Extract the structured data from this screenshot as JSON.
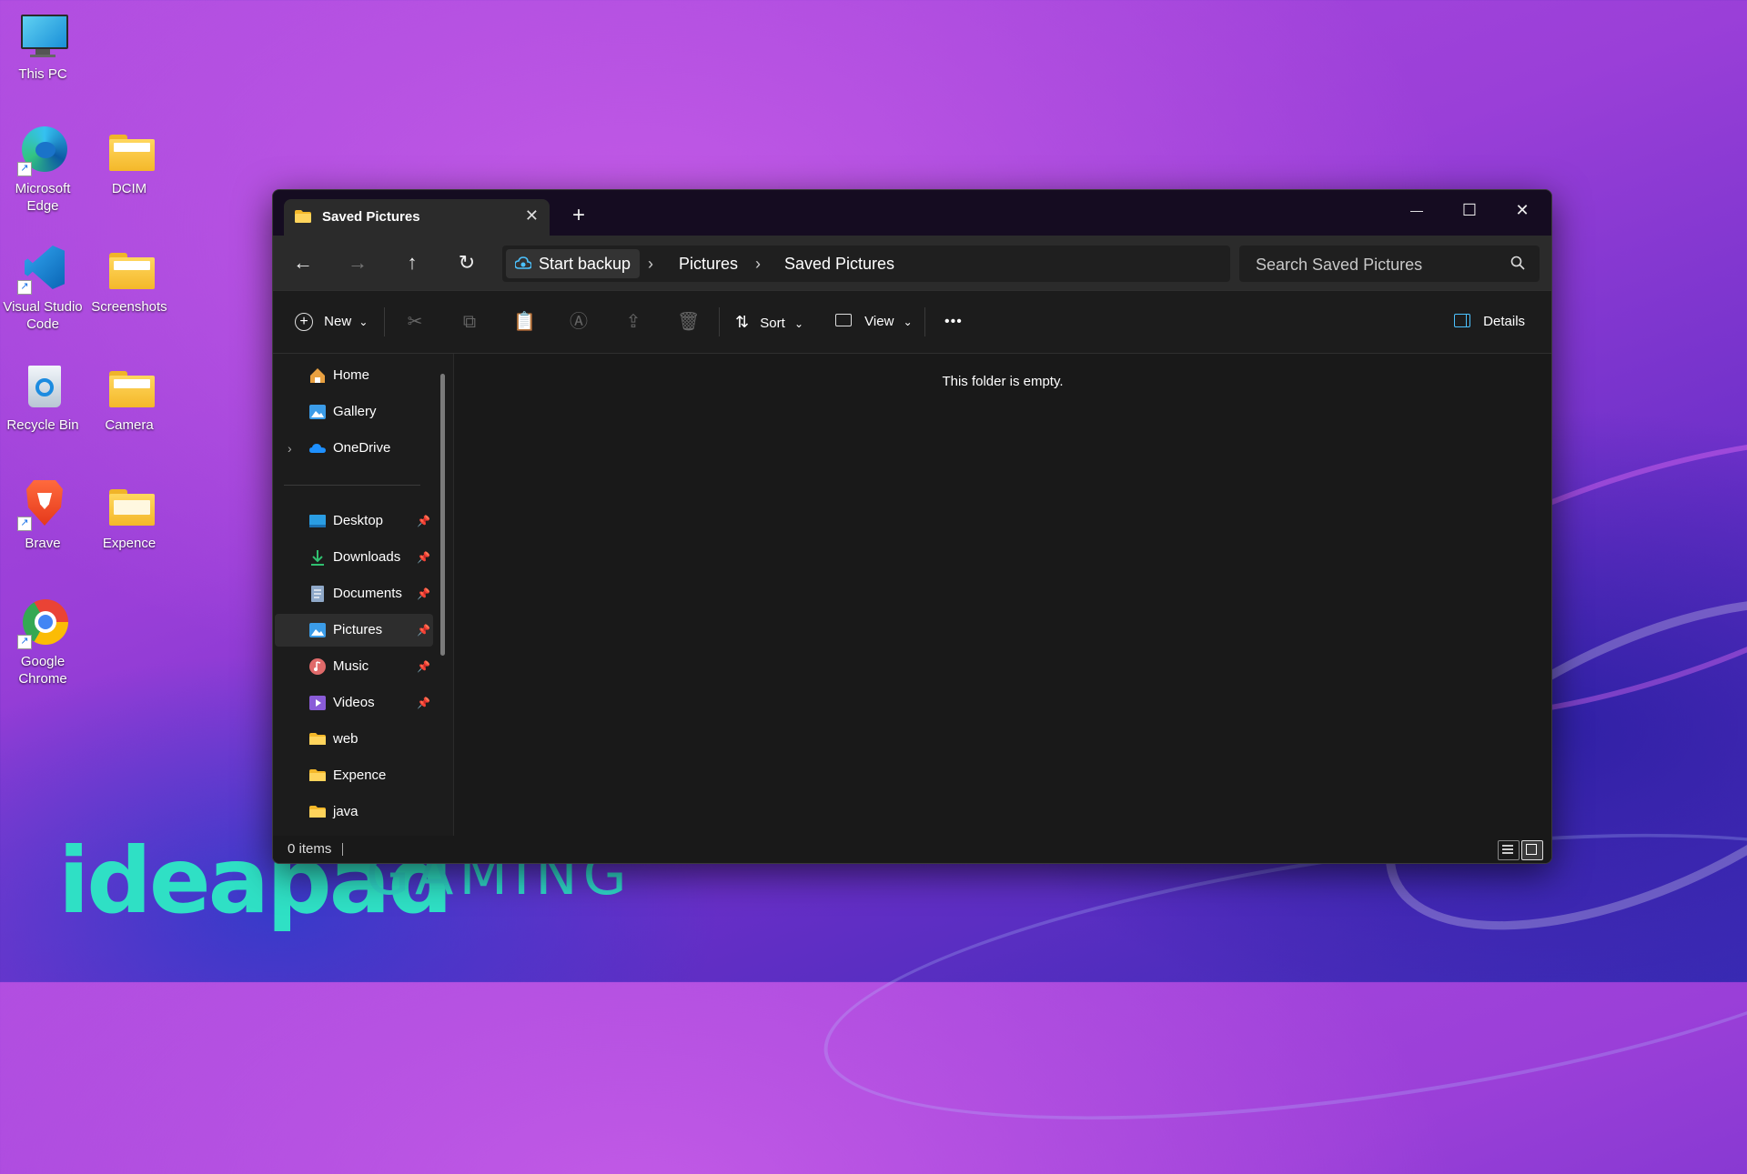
{
  "desktop": {
    "icons": [
      {
        "label": "This PC"
      },
      {
        "label": "Microsoft Edge"
      },
      {
        "label": "DCIM"
      },
      {
        "label": "Visual Studio Code"
      },
      {
        "label": "Screenshots"
      },
      {
        "label": "Recycle Bin"
      },
      {
        "label": "Camera"
      },
      {
        "label": "Brave"
      },
      {
        "label": "Expence"
      },
      {
        "label": "Google Chrome"
      }
    ],
    "wallpaper_brand": "ideapad",
    "wallpaper_brand_suffix": "GAMING"
  },
  "window": {
    "tab_title": "Saved Pictures",
    "tab_close": "✕",
    "new_tab": "+",
    "minimize": "—",
    "maximize": "☐",
    "close": "✕"
  },
  "navbar": {
    "back": "←",
    "forward": "→",
    "up": "↑",
    "refresh": "↻",
    "backup_label": "Start backup",
    "breadcrumbs": [
      "Pictures",
      "Saved Pictures"
    ],
    "separator": "›",
    "search_placeholder": "Search Saved Pictures"
  },
  "toolbar": {
    "new_label": "New",
    "sort_label": "Sort",
    "view_label": "View",
    "more": "•••",
    "details_label": "Details",
    "dropdown_caret": "⌄"
  },
  "sidebar": {
    "top_items": [
      {
        "label": "Home",
        "icon": "home-icon"
      },
      {
        "label": "Gallery",
        "icon": "gallery-icon"
      },
      {
        "label": "OneDrive",
        "icon": "onedrive-icon"
      }
    ],
    "quick_access": [
      {
        "label": "Desktop",
        "icon": "desktop-icon",
        "pinned": true
      },
      {
        "label": "Downloads",
        "icon": "download-icon",
        "pinned": true
      },
      {
        "label": "Documents",
        "icon": "documents-icon",
        "pinned": true
      },
      {
        "label": "Pictures",
        "icon": "pictures-icon",
        "pinned": true,
        "active": true
      },
      {
        "label": "Music",
        "icon": "music-icon",
        "pinned": true
      },
      {
        "label": "Videos",
        "icon": "videos-icon",
        "pinned": true
      },
      {
        "label": "web",
        "icon": "folder-icon"
      },
      {
        "label": "Expence",
        "icon": "folder-icon"
      },
      {
        "label": "java",
        "icon": "folder-icon"
      }
    ],
    "chevron": "›",
    "pin": "📌"
  },
  "main": {
    "empty_message": "This folder is empty."
  },
  "status": {
    "item_count": "0 items"
  },
  "colors": {
    "window_bg": "#191919",
    "titlebar_bg": "#150c21",
    "accent": "#4cc2ff",
    "folder_yellow": "#f4b82a",
    "brand_teal": "#2fe0c5"
  }
}
